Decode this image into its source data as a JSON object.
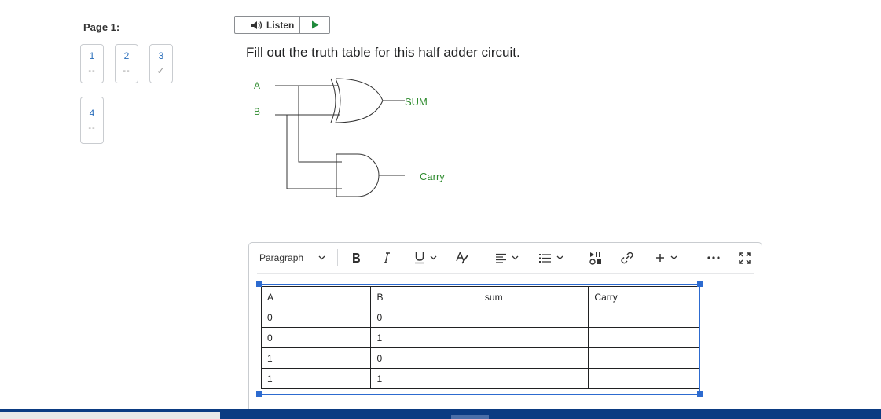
{
  "nav": {
    "page_label": "Page 1:",
    "questions": [
      {
        "number": "1",
        "status": "--"
      },
      {
        "number": "2",
        "status": "--"
      },
      {
        "number": "3",
        "status": "✓"
      },
      {
        "number": "4",
        "status": "--"
      }
    ]
  },
  "listen": {
    "label": "Listen"
  },
  "question": {
    "text": "Fill out the truth table for this half adder circuit."
  },
  "circuit": {
    "input_a": "A",
    "input_b": "B",
    "output_sum": "SUM",
    "output_carry": "Carry",
    "label_color": "#2e8b2e"
  },
  "editor": {
    "block_format": "Paragraph",
    "icons": [
      "bold-icon",
      "italic-icon",
      "underline-icon",
      "text-color-icon",
      "align-icon",
      "list-icon",
      "insert-media-icon",
      "link-icon",
      "insert-plus-icon",
      "more-icon",
      "fullscreen-icon"
    ]
  },
  "truth_table": {
    "headers": [
      "A",
      "B",
      "sum",
      "Carry"
    ],
    "rows": [
      [
        "0",
        "0",
        "",
        ""
      ],
      [
        "0",
        "1",
        "",
        ""
      ],
      [
        "1",
        "0",
        "",
        ""
      ],
      [
        "1",
        "1",
        "",
        ""
      ]
    ]
  },
  "colors": {
    "accent": "#2d6bd0",
    "green": "#2e8b2e",
    "footer": "#0b3b82"
  }
}
